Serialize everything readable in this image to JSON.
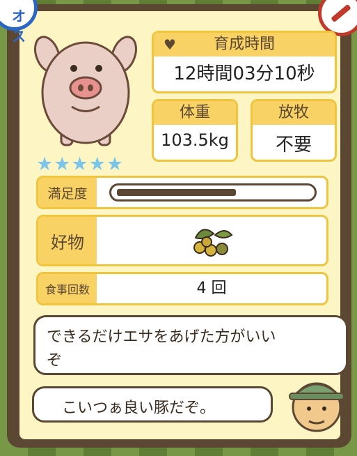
{
  "badges": {
    "gender_label": "オス",
    "gender_icon": "male-badge",
    "action_icon": "syringe-icon"
  },
  "pig": {
    "rating_stars": 5,
    "rating_text": "★★★★★"
  },
  "growth_time": {
    "label": "育成時間",
    "value": "12時間03分10秒",
    "icon": "heart-icon"
  },
  "weight": {
    "label": "体重",
    "value": "103.5kg"
  },
  "grazing": {
    "label": "放牧",
    "value": "不要"
  },
  "satisfaction": {
    "label": "満足度",
    "level": 0.62
  },
  "favorite": {
    "label": "好物",
    "item_icon": "soybean-icon"
  },
  "meals": {
    "label": "食事回数",
    "value": "4 回"
  },
  "advice_bubble": {
    "line1": "できるだけエサをあげた方がいい",
    "line2": "ぞ"
  },
  "comment_bubble": {
    "text": "こいつぁ良い豚だぞ。"
  },
  "colors": {
    "frame": "#5c4733",
    "panel_bg": "#fdf6c4",
    "accent": "#f8d264",
    "star": "#7cc4e8"
  }
}
